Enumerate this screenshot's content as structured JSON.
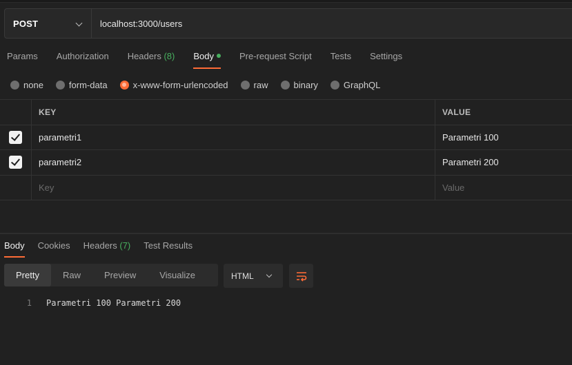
{
  "request": {
    "method": "POST",
    "url": "localhost:3000/users"
  },
  "request_tabs": [
    {
      "label": "Params"
    },
    {
      "label": "Authorization"
    },
    {
      "label": "Headers",
      "count": "(8)"
    },
    {
      "label": "Body",
      "active": true
    },
    {
      "label": "Pre-request Script"
    },
    {
      "label": "Tests"
    },
    {
      "label": "Settings"
    }
  ],
  "body_types": [
    {
      "label": "none",
      "selected": false
    },
    {
      "label": "form-data",
      "selected": false
    },
    {
      "label": "x-www-form-urlencoded",
      "selected": true
    },
    {
      "label": "raw",
      "selected": false
    },
    {
      "label": "binary",
      "selected": false
    },
    {
      "label": "GraphQL",
      "selected": false
    }
  ],
  "params_table": {
    "headers": {
      "key": "KEY",
      "value": "VALUE"
    },
    "rows": [
      {
        "checked": true,
        "key": "parametri1",
        "value": "Parametri 100"
      },
      {
        "checked": true,
        "key": "parametri2",
        "value": "Parametri 200"
      }
    ],
    "placeholder": {
      "key": "Key",
      "value": "Value"
    }
  },
  "response_tabs": [
    {
      "label": "Body",
      "active": true
    },
    {
      "label": "Cookies"
    },
    {
      "label": "Headers",
      "count": "(7)"
    },
    {
      "label": "Test Results"
    }
  ],
  "view_modes": [
    "Pretty",
    "Raw",
    "Preview",
    "Visualize"
  ],
  "active_view_mode": "Pretty",
  "format": "HTML",
  "response_body": {
    "line_number": "1",
    "text": "Parametri 100 Parametri 200"
  },
  "colors": {
    "accent": "#ff6c37",
    "green": "#48b05f",
    "background": "#212121"
  },
  "icons": [
    "chevron-down-icon",
    "check-icon",
    "wrap-lines-icon"
  ]
}
